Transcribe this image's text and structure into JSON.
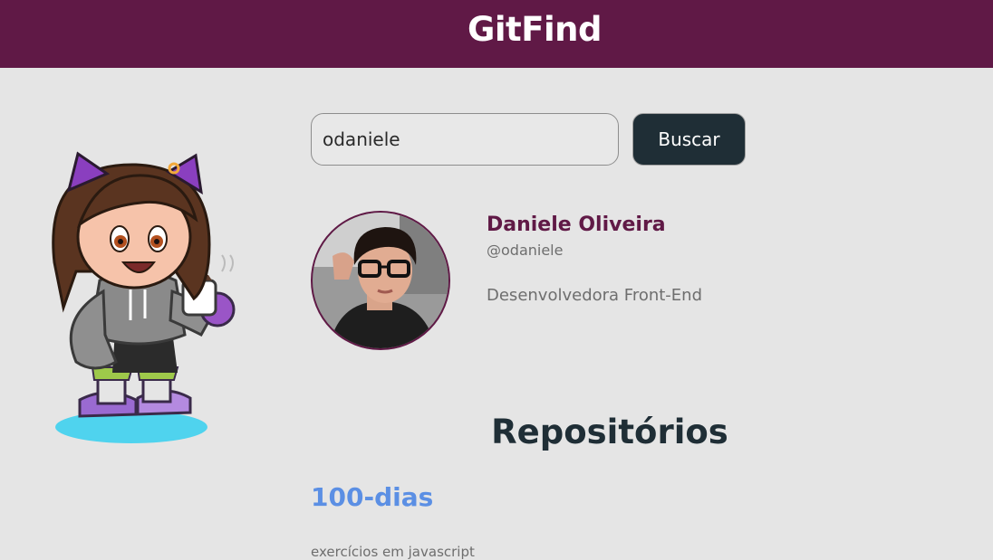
{
  "header": {
    "title": "GitFind"
  },
  "search": {
    "value": "odaniele",
    "button_label": "Buscar"
  },
  "profile": {
    "name": "Daniele Oliveira",
    "login": "@odaniele",
    "bio": "Desenvolvedora Front-End"
  },
  "repositories": {
    "title": "Repositórios",
    "items": [
      {
        "name": "100-dias",
        "description": "exercícios em javascript"
      }
    ]
  },
  "colors": {
    "header": "#601946",
    "background": "#e5e5e5",
    "button": "#1f2e36",
    "profile_name": "#601946",
    "repo_link": "#5b8fe4"
  },
  "icons": {
    "mascot": "github-octocat-girl-illustration"
  }
}
